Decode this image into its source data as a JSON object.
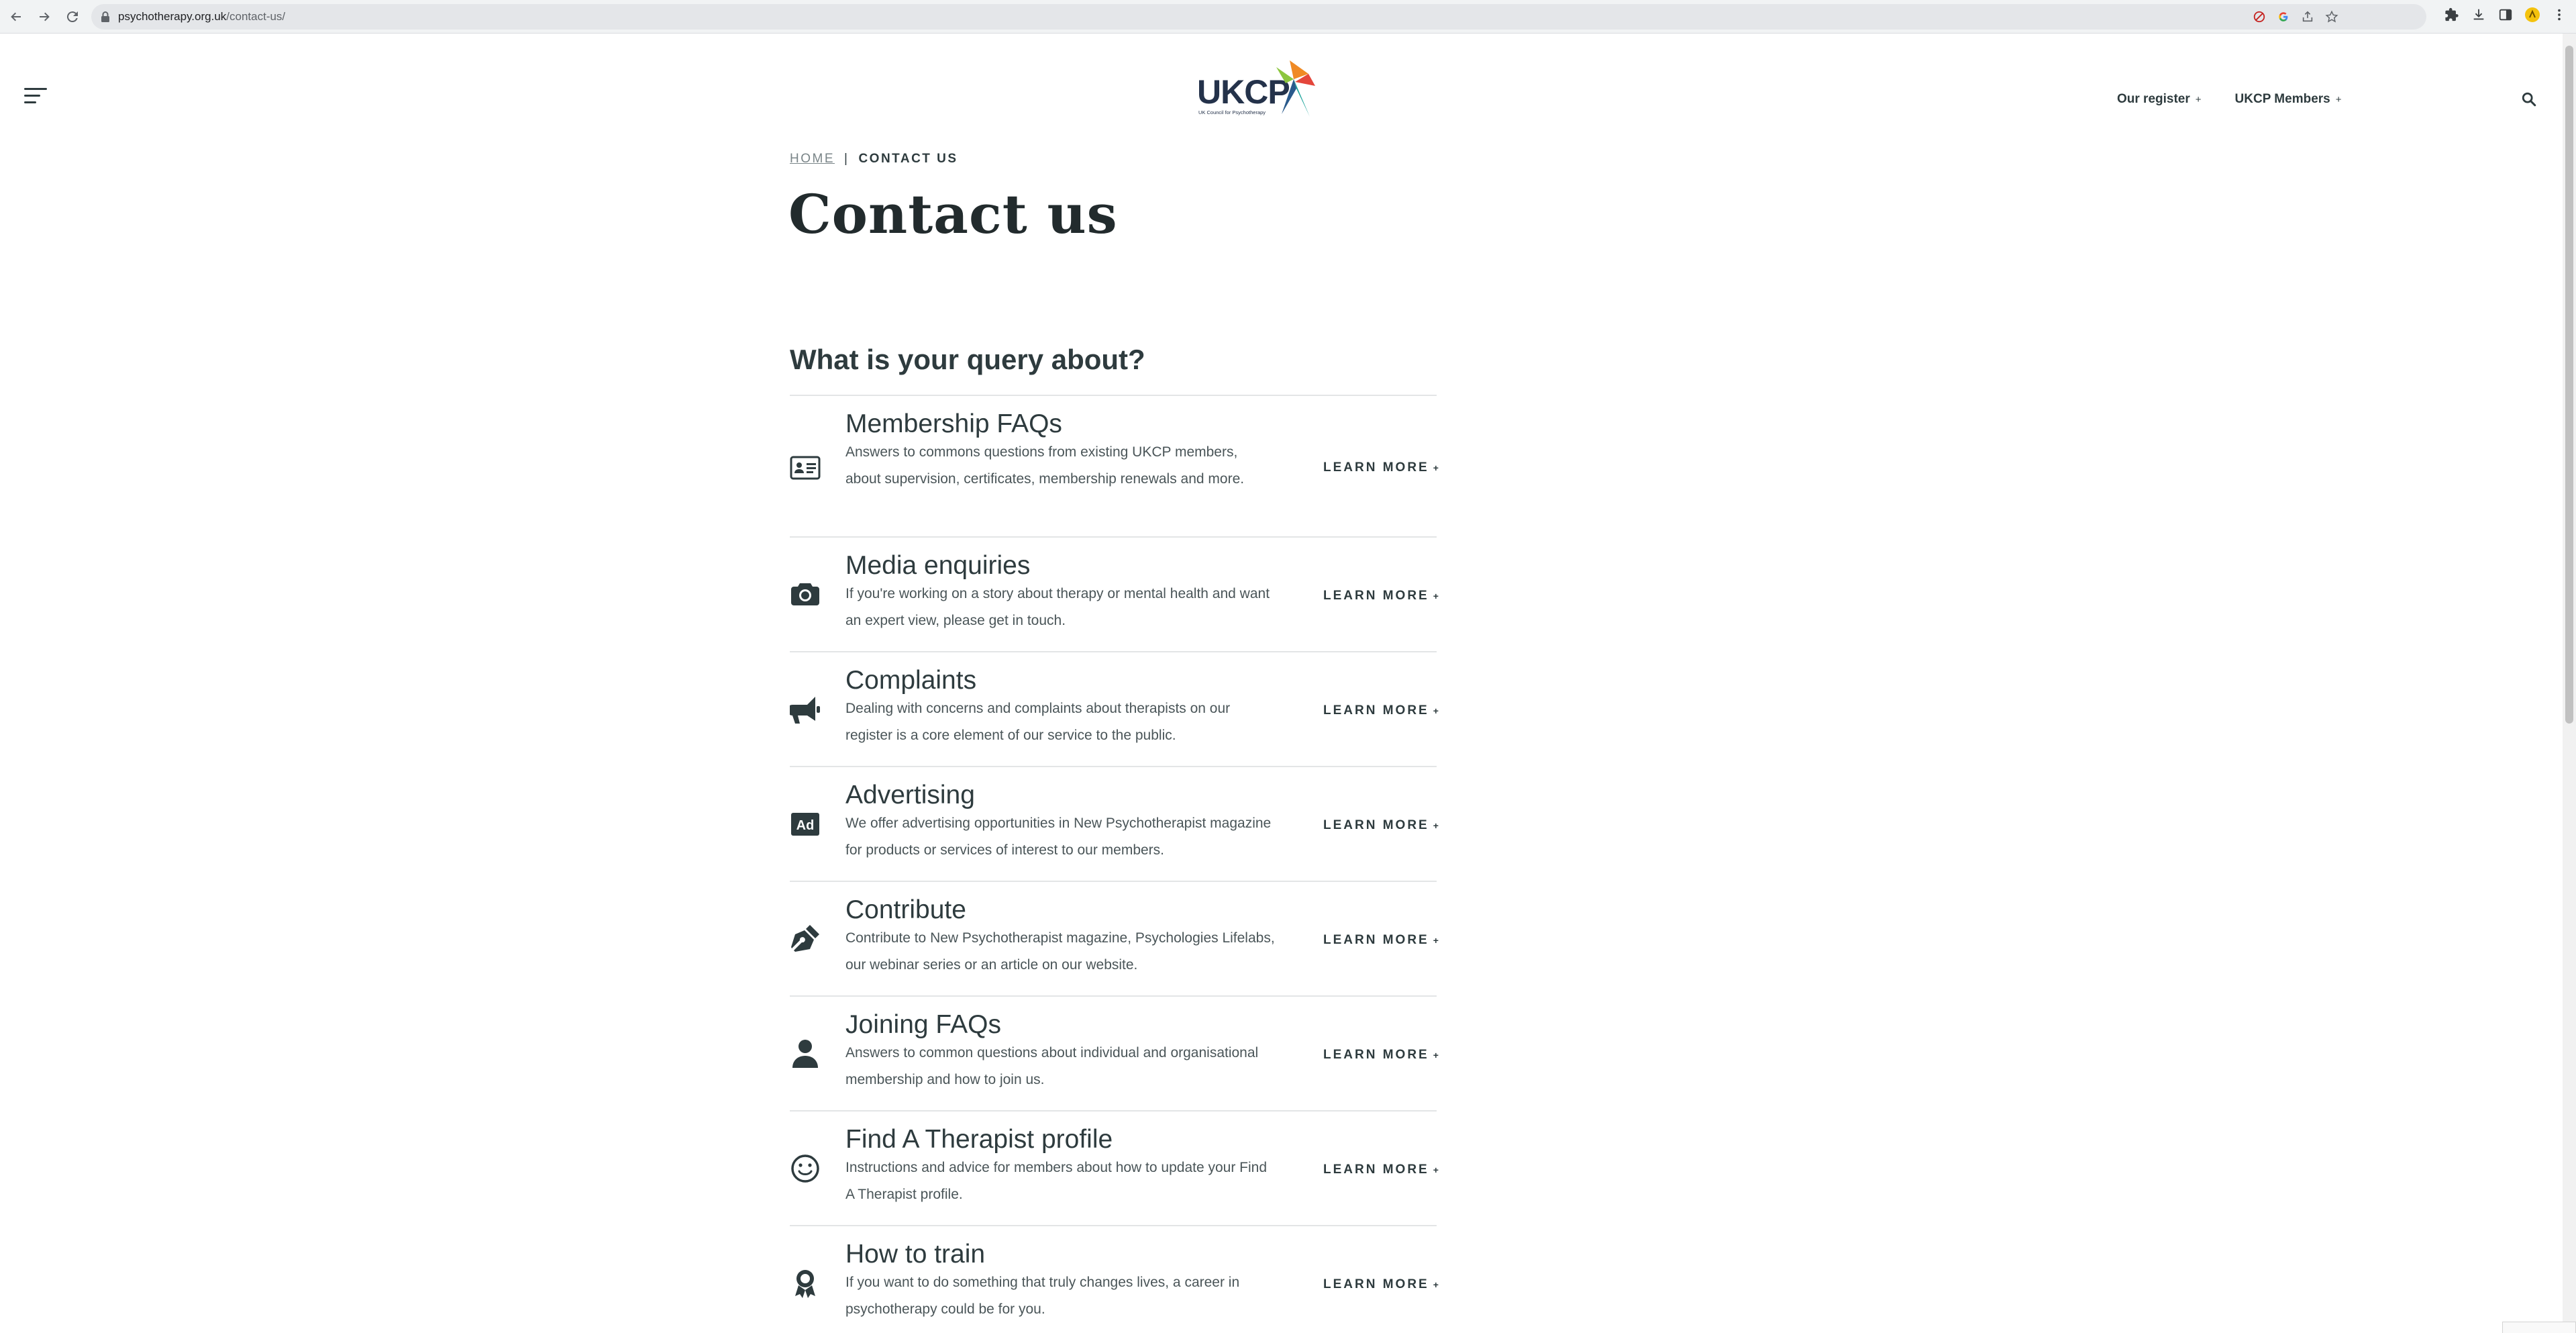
{
  "browser": {
    "url_domain": "psychotherapy.org.uk",
    "url_path": "/contact-us/"
  },
  "header": {
    "logo_text": "UKCP",
    "logo_tagline": "UK Council for Psychotherapy",
    "nav": [
      {
        "label": "Our register"
      },
      {
        "label": "UKCP Members"
      }
    ]
  },
  "breadcrumb": {
    "home": "HOME",
    "separator": "|",
    "current": "CONTACT US"
  },
  "page": {
    "title": "Contact us",
    "query_heading": "What is your query about?"
  },
  "queries": [
    {
      "icon": "id-card-icon",
      "title": "Membership FAQs",
      "desc": "Answers to commons questions from existing UKCP members, about supervision, certificates, membership renewals and more.",
      "cta": "LEARN MORE"
    },
    {
      "icon": "camera-icon",
      "title": "Media enquiries",
      "desc": "If you're working on a story about therapy or mental health and want an expert view, please get in touch.",
      "cta": "LEARN MORE"
    },
    {
      "icon": "megaphone-icon",
      "title": "Complaints",
      "desc": "Dealing with concerns and complaints about therapists on our register is a core element of our service to the public.",
      "cta": "LEARN MORE"
    },
    {
      "icon": "ad-icon",
      "title": "Advertising",
      "desc": "We offer advertising opportunities in New Psychotherapist magazine for products or services of interest to our members.",
      "cta": "LEARN MORE"
    },
    {
      "icon": "pen-nib-icon",
      "title": "Contribute",
      "desc": "Contribute to New Psychotherapist magazine, Psychologies Lifelabs, our webinar series or an article on our website.",
      "cta": "LEARN MORE"
    },
    {
      "icon": "user-icon",
      "title": "Joining FAQs",
      "desc": "Answers to common questions about individual and organisational membership and how to join us.",
      "cta": "LEARN MORE"
    },
    {
      "icon": "smile-icon",
      "title": "Find A Therapist profile",
      "desc": "Instructions and advice for members about how to update your Find A Therapist profile.",
      "cta": "LEARN MORE"
    },
    {
      "icon": "award-icon",
      "title": "How to train",
      "desc": "If you want to do something that truly changes lives, a career in psychotherapy could be for you.",
      "cta": "LEARN MORE"
    }
  ],
  "colors": {
    "text": "#2e3b3e",
    "logo_blue": "#2a5a8c",
    "logo_orange": "#f08a24",
    "logo_teal": "#1aa39a",
    "logo_red": "#e4463b"
  }
}
